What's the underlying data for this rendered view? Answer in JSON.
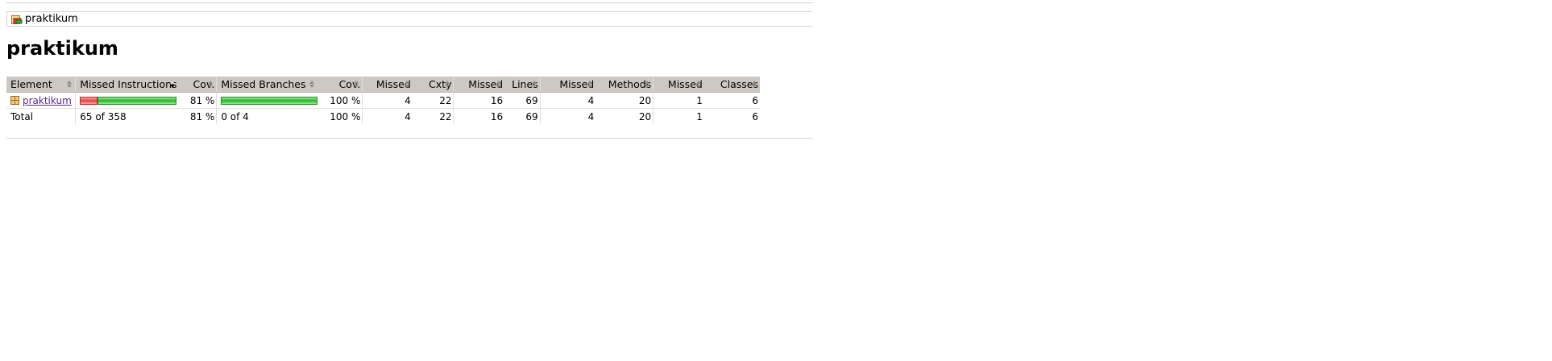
{
  "breadcrumb": {
    "icon": "report-icon",
    "label": "praktikum"
  },
  "page_title": "praktikum",
  "table": {
    "headers": [
      {
        "label": "Element",
        "sorted": false
      },
      {
        "label": "Missed Instructions",
        "sorted": true
      },
      {
        "label": "Cov.",
        "sorted": false
      },
      {
        "label": "Missed Branches",
        "sorted": false
      },
      {
        "label": "Cov.",
        "sorted": false
      },
      {
        "label": "Missed",
        "sorted": false
      },
      {
        "label": "Cxty",
        "sorted": false
      },
      {
        "label": "Missed",
        "sorted": false
      },
      {
        "label": "Lines",
        "sorted": false
      },
      {
        "label": "Missed",
        "sorted": false
      },
      {
        "label": "Methods",
        "sorted": false
      },
      {
        "label": "Missed",
        "sorted": false
      },
      {
        "label": "Classes",
        "sorted": false
      }
    ],
    "rows": [
      {
        "element": "praktikum",
        "element_icon": "package-icon",
        "instructions_missed_fraction": 0.18,
        "instructions_cov": "81 %",
        "branches_missed_fraction": 0.0,
        "branches_cov": "100 %",
        "cxty_missed": "4",
        "cxty": "22",
        "lines_missed": "16",
        "lines": "69",
        "methods_missed": "4",
        "methods": "20",
        "classes_missed": "1",
        "classes": "6"
      }
    ],
    "total": {
      "label": "Total",
      "instructions": "65 of 358",
      "instructions_cov": "81 %",
      "branches": "0 of 4",
      "branches_cov": "100 %",
      "cxty_missed": "4",
      "cxty": "22",
      "lines_missed": "16",
      "lines": "69",
      "methods_missed": "4",
      "methods": "20",
      "classes_missed": "1",
      "classes": "6"
    }
  },
  "colors": {
    "missed_bar": "#e54545",
    "covered_bar": "#26b526",
    "header_bg": "#ccc9c4",
    "link": "#5b2b8a"
  }
}
